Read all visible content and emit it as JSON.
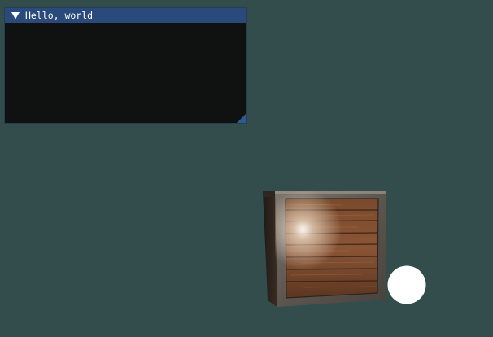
{
  "window": {
    "title": "Hello, world",
    "collapse_icon": "triangle-down-icon"
  },
  "colors": {
    "background": "#334d4d",
    "window_bg": "#101212",
    "title_bar": "#294a7a",
    "resize_grip": "#2d5a8f",
    "light_source": "#ffffff"
  },
  "scene": {
    "objects": [
      "wooden-crate",
      "light-sphere"
    ]
  }
}
